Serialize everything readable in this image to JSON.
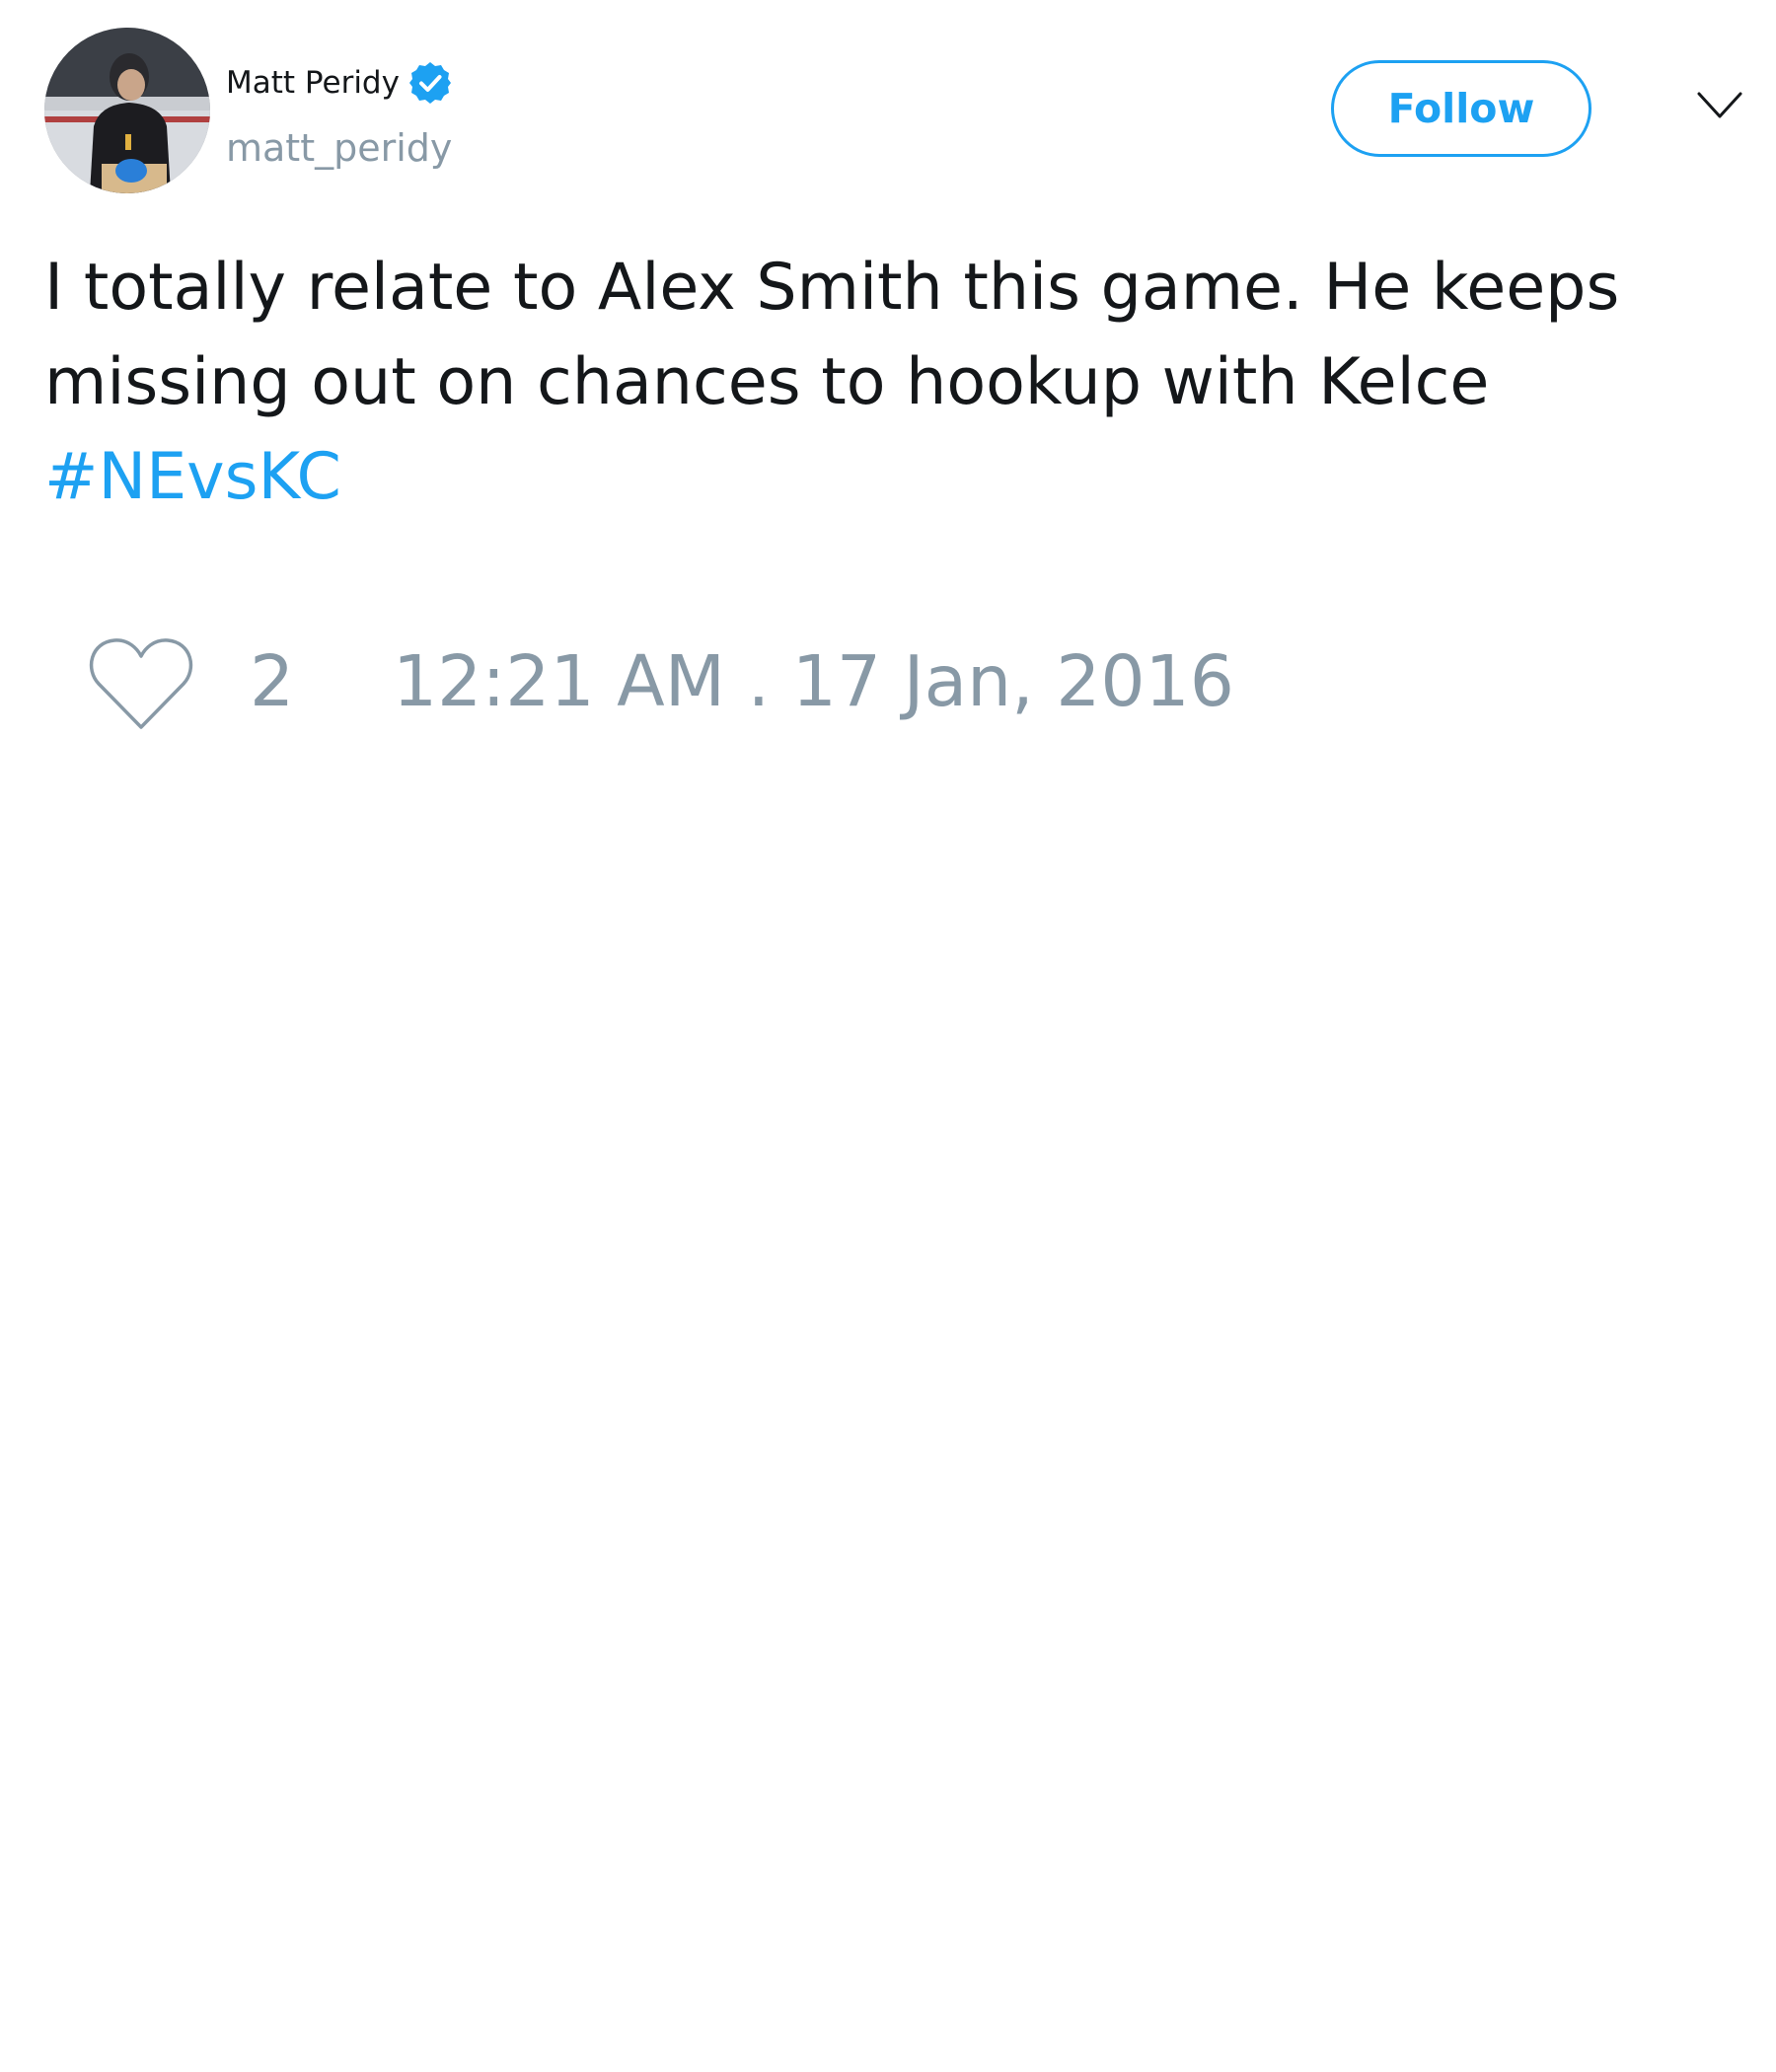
{
  "tweet": {
    "author": {
      "display_name": "Matt Peridy",
      "handle": "matt_peridy",
      "verified": true,
      "avatar_icon": "profile-photo"
    },
    "follow_label": "Follow",
    "menu_icon": "chevron-down-icon",
    "text": "I totally relate to Alex Smith this game. He keeps missing out on chances to hookup with Kelce",
    "hashtag": "#NEvsKC",
    "likes": {
      "icon": "heart-icon",
      "count": "2"
    },
    "timestamp": "12:21 AM . 17 Jan, 2016"
  },
  "colors": {
    "accent": "#1da1f2",
    "text": "#14171a",
    "secondary": "#8899a6",
    "background": "#ffffff"
  }
}
